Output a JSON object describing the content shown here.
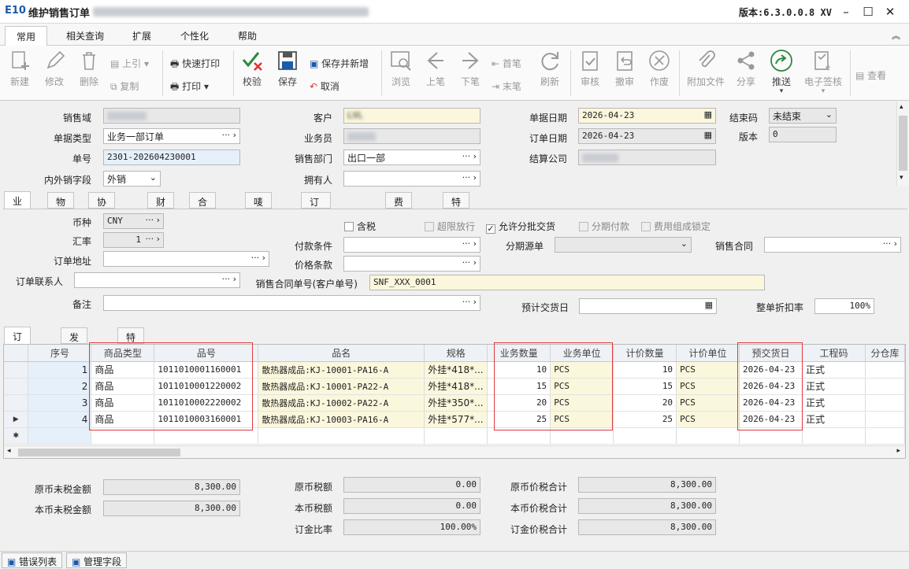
{
  "window": {
    "logo": "E10",
    "title": "维护销售订单",
    "version": "版本:6.3.0.0.8 XV"
  },
  "menu": [
    "常用",
    "相关查询",
    "扩展",
    "个性化",
    "帮助"
  ],
  "toolbar": {
    "new": "新建",
    "edit": "修改",
    "delete": "删除",
    "prev_rec": "上引",
    "copy": "复制",
    "quick_print": "快速打印",
    "print": "打印",
    "verify": "校验",
    "save": "保存",
    "save_new": "保存并新增",
    "cancel": "取消",
    "browse": "浏览",
    "prev": "上笔",
    "next": "下笔",
    "first": "首笔",
    "last": "末笔",
    "refresh": "刷新",
    "approve": "审核",
    "unapprove": "撤审",
    "void": "作废",
    "attach": "附加文件",
    "share": "分享",
    "push": "推送",
    "esign": "电子签核",
    "view": "查看"
  },
  "header": {
    "sales_domain_label": "销售域",
    "doc_type_label": "单据类型",
    "doc_type": "业务一部订单",
    "doc_no_label": "单号",
    "doc_no": "2301-202604230001",
    "trade_field_label": "内外销字段",
    "trade_field": "外销",
    "customer_label": "客户",
    "customer": "LVL",
    "salesman_label": "业务员",
    "dept_label": "销售部门",
    "dept": "出口一部",
    "owner_label": "拥有人",
    "doc_date_label": "单据日期",
    "doc_date": "2026-04-23",
    "order_date_label": "订单日期",
    "order_date": "2026-04-23",
    "settle_company_label": "结算公司",
    "close_code_label": "结束码",
    "close_code": "未结束",
    "version_label": "版本",
    "version": "0"
  },
  "tabs": [
    "业务",
    "物流",
    "协同交易",
    "财务",
    "合同信息",
    "唛头信息",
    "订金/分期明细",
    "费用组成",
    "特殊成本"
  ],
  "business": {
    "currency_label": "币种",
    "currency": "CNY",
    "rate_label": "汇率",
    "rate": "1",
    "address_label": "订单地址",
    "contact_label": "订单联系人",
    "remark_label": "备注",
    "tax_incl": "含税",
    "over_limit": "超限放行",
    "allow_split": "允许分批交货",
    "installment": "分期付款",
    "fee_lock": "费用组成锁定",
    "pay_terms_label": "付款条件",
    "price_terms_label": "价格条款",
    "contract_no_label": "销售合同单号(客户单号)",
    "contract_no": "SNF_XXX_0001",
    "installment_src_label": "分期源单",
    "sales_contract_label": "销售合同",
    "expected_delivery_label": "预计交货日",
    "discount_label": "整单折扣率",
    "discount": "100%"
  },
  "detail_tabs": [
    "订单明细",
    "发货计划",
    "特殊成本"
  ],
  "grid": {
    "columns": [
      "序号",
      "商品类型",
      "品号",
      "品名",
      "规格",
      "业务数量",
      "业务单位",
      "计价数量",
      "计价单位",
      "预交货日",
      "工程码",
      "分仓库"
    ],
    "rows": [
      {
        "no": "1",
        "type": "商品",
        "code": "1011010001160001",
        "name": "散热器成品:KJ-10001-PA16-A",
        "spec": "外挂*418*...",
        "qty": "10",
        "unit": "PCS",
        "pqty": "10",
        "punit": "PCS",
        "date": "2026-04-23",
        "proj": "正式"
      },
      {
        "no": "2",
        "type": "商品",
        "code": "1011010001220002",
        "name": "散热器成品:KJ-10001-PA22-A",
        "spec": "外挂*418*...",
        "qty": "15",
        "unit": "PCS",
        "pqty": "15",
        "punit": "PCS",
        "date": "2026-04-23",
        "proj": "正式"
      },
      {
        "no": "3",
        "type": "商品",
        "code": "1011010002220002",
        "name": "散热器成品:KJ-10002-PA22-A",
        "spec": "外挂*350*...",
        "qty": "20",
        "unit": "PCS",
        "pqty": "20",
        "punit": "PCS",
        "date": "2026-04-23",
        "proj": "正式"
      },
      {
        "no": "4",
        "type": "商品",
        "code": "1011010003160001",
        "name": "散热器成品:KJ-10003-PA16-A",
        "spec": "外挂*577*...",
        "qty": "25",
        "unit": "PCS",
        "pqty": "25",
        "punit": "PCS",
        "date": "2026-04-23",
        "proj": "正式"
      }
    ]
  },
  "totals": {
    "orig_untaxed_label": "原币未税金额",
    "orig_untaxed": "8,300.00",
    "local_untaxed_label": "本币未税金额",
    "local_untaxed": "8,300.00",
    "orig_tax_label": "原币税额",
    "orig_tax": "0.00",
    "local_tax_label": "本币税额",
    "local_tax": "0.00",
    "deposit_ratio_label": "订金比率",
    "deposit_ratio": "100.00%",
    "orig_total_label": "原币价税合计",
    "orig_total": "8,300.00",
    "local_total_label": "本币价税合计",
    "local_total": "8,300.00",
    "deposit_total_label": "订金价税合计",
    "deposit_total": "8,300.00"
  },
  "bottom_tabs": [
    "错误列表",
    "管理字段"
  ]
}
